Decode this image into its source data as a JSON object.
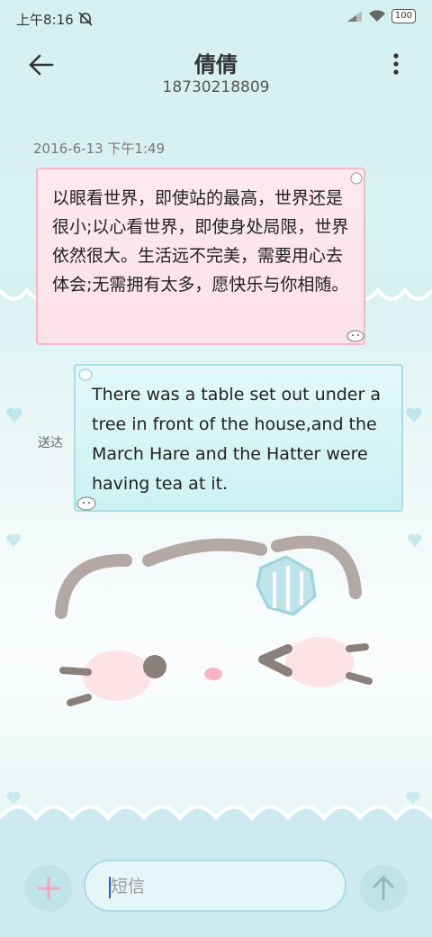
{
  "status_bar": {
    "time": "上午8:16",
    "battery": "100"
  },
  "header": {
    "contact_name": "倩倩",
    "phone_number": "18730218809"
  },
  "conversation": {
    "timestamp": "2016-6-13 下午1:49",
    "messages": [
      {
        "direction": "incoming",
        "text": "以眼看世界，即使站的最高，世界还是很小;以心看世界，即使身处局限，世界依然很大。生活远不完美，需要用心去体会;无需拥有太多，愿快乐与你相随。"
      },
      {
        "direction": "outgoing",
        "text": "There was a table set out under a tree in front of the house,and the March Hare and the Hatter were having tea at it.",
        "status": "送达"
      }
    ]
  },
  "composer": {
    "placeholder": "短信"
  },
  "colors": {
    "incoming_bubble": "#fde9f1",
    "outgoing_bubble": "#d8f5f7",
    "accent_pink": "#f3a7bd",
    "accent_teal": "#a6dfe5"
  },
  "icons": {
    "back": "arrow-left-icon",
    "menu": "more-vert-icon",
    "add": "plus-icon",
    "send": "arrow-up-icon"
  }
}
